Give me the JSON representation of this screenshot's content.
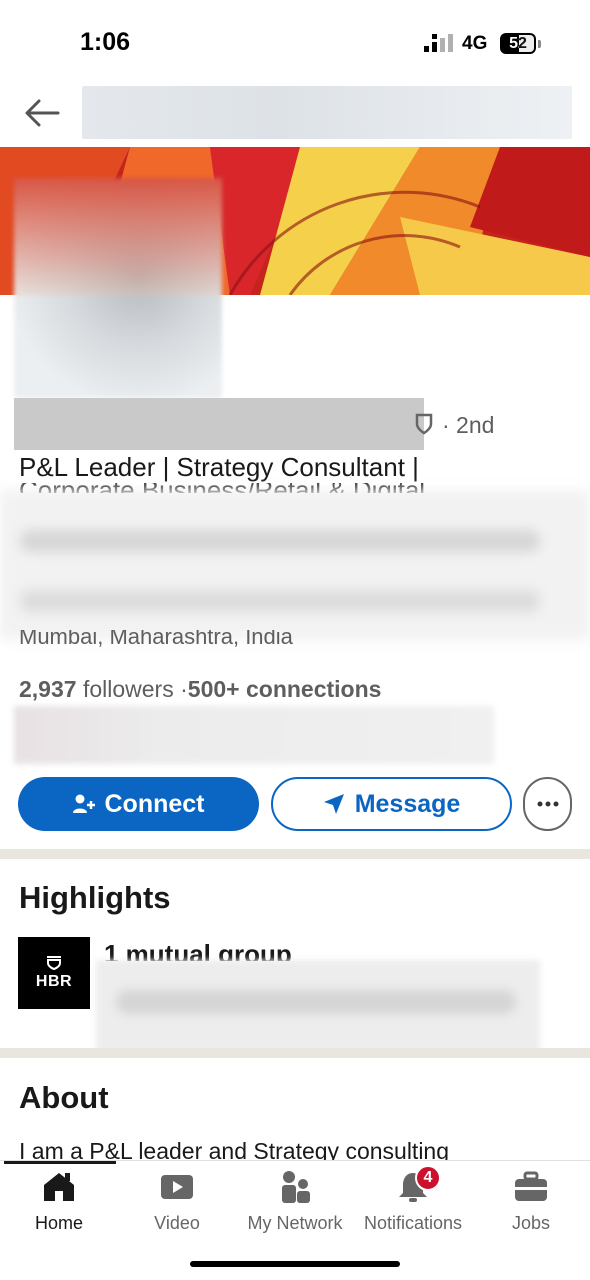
{
  "status_bar": {
    "time": "1:06",
    "network": "4G",
    "battery": "52",
    "icons": [
      "signal-icon",
      "battery-icon"
    ]
  },
  "top_nav": {
    "icons": [
      "back-arrow-icon"
    ]
  },
  "profile": {
    "degree": "· 2nd",
    "headline": "P&L Leader | Strategy Consultant |",
    "headline_cut": "Corporate Business/Retail & Digital",
    "location": "Mumbai, Maharashtra, India",
    "followers_count": "2,937",
    "followers_label": "followers",
    "separator": "·",
    "connections": "500+ connections"
  },
  "actions": {
    "connect_label": "Connect",
    "message_label": "Message",
    "icons": [
      "add-person-icon",
      "send-icon",
      "more-icon"
    ]
  },
  "highlights": {
    "title": "Highlights",
    "logo_text": "HBR",
    "mutual_group": "1 mutual group"
  },
  "about": {
    "title": "About",
    "text": "I am a P&L leader and Strategy consulting"
  },
  "bottom_nav": {
    "items": [
      {
        "label": "Home",
        "icon": "home-icon",
        "active": true
      },
      {
        "label": "Video",
        "icon": "video-icon"
      },
      {
        "label": "My Network",
        "icon": "my-network-icon"
      },
      {
        "label": "Notifications",
        "icon": "bell-icon",
        "badge": "4"
      },
      {
        "label": "Jobs",
        "icon": "briefcase-icon"
      }
    ]
  },
  "colors": {
    "primary": "#0a66c2",
    "badge": "#cb112d",
    "banner_red": "#c4241b",
    "banner_orange": "#f0682a",
    "banner_yellow": "#f5d04a"
  }
}
